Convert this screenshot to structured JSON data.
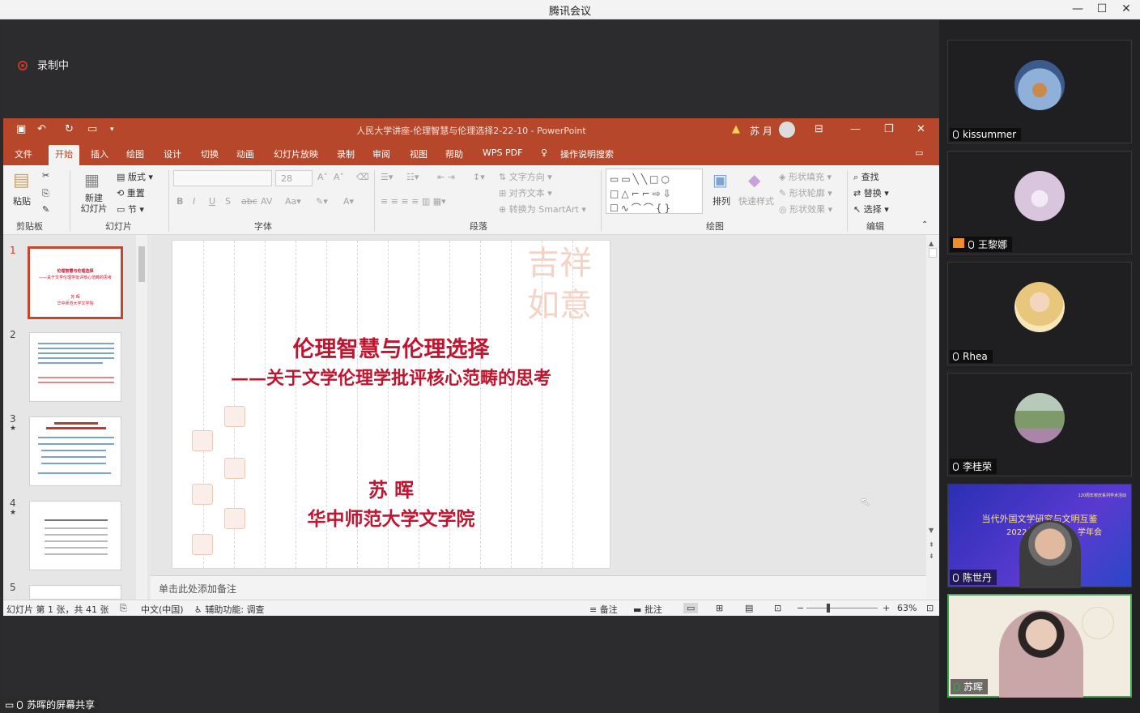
{
  "window": {
    "title": "腾讯会议"
  },
  "recording": {
    "label": "录制中"
  },
  "ppt": {
    "doc_title": "人民大学讲座-伦理智慧与伦理选择2-22-10  -  PowerPoint",
    "user": "苏 月",
    "tabs": [
      "文件",
      "开始",
      "插入",
      "绘图",
      "设计",
      "切换",
      "动画",
      "幻灯片放映",
      "录制",
      "审阅",
      "视图",
      "帮助",
      "WPS PDF",
      "操作说明搜索"
    ],
    "ribbon": {
      "paste": "粘贴",
      "new_slide": "新建\n幻灯片",
      "layout": "版式",
      "reset": "重置",
      "section": "节",
      "font_size": "28",
      "text_dir": "文字方向",
      "align_text": "对齐文本",
      "smartart": "转换为 SmartArt",
      "arrange": "排列",
      "quick_style": "快速样式",
      "shape_fill": "形状填充",
      "shape_outline": "形状轮廓",
      "shape_effect": "形状效果",
      "find": "查找",
      "replace": "替换",
      "select": "选择",
      "groups": {
        "clipboard": "剪贴板",
        "slides": "幻灯片",
        "font": "字体",
        "paragraph": "段落",
        "drawing": "绘图",
        "editing": "编辑"
      }
    },
    "thumb_numbers": [
      "1",
      "2",
      "3",
      "4",
      "5"
    ],
    "slide": {
      "title": "伦理智慧与伦理选择",
      "subtitle": "——关于文学伦理学批评核心范畴的思考",
      "author": "苏  晖",
      "affiliation": "华中师范大学文学院",
      "thumb_title": "伦理智慧与伦理选择",
      "thumb_sub": "——关于文学伦理学批评核心范畴的思考",
      "thumb_author": "苏 晖",
      "thumb_aff": "华中师范大学文学院"
    },
    "notes_placeholder": "单击此处添加备注",
    "status": {
      "slide_info": "幻灯片 第 1 张，共 41 张",
      "lang": "中文(中国)",
      "accessibility": "辅助功能: 调查",
      "notes": "备注",
      "comments": "批注",
      "zoom": "63%"
    }
  },
  "share_label": "苏晖的屏幕共享",
  "participants": [
    {
      "name": "kissummer",
      "avatar_color": "#5b7fb8"
    },
    {
      "name": "王黎娜",
      "avatar_color": "#d9c5de"
    },
    {
      "name": "Rhea",
      "avatar_color": "#e8c77c"
    },
    {
      "name": "李桂荣",
      "avatar_color": "#7f9a6a"
    },
    {
      "name": "陈世丹",
      "banner_line1": "当代外国文学研究与文明互鉴",
      "banner_line2": "2022年",
      "banner_line3": "学年会",
      "banner_top": "120周年校庆系列学术活动"
    },
    {
      "name": "苏晖"
    }
  ],
  "colors": {
    "ppt_accent": "#b7472a",
    "slide_red": "#c0142f",
    "active_speaker": "#3aa856"
  }
}
